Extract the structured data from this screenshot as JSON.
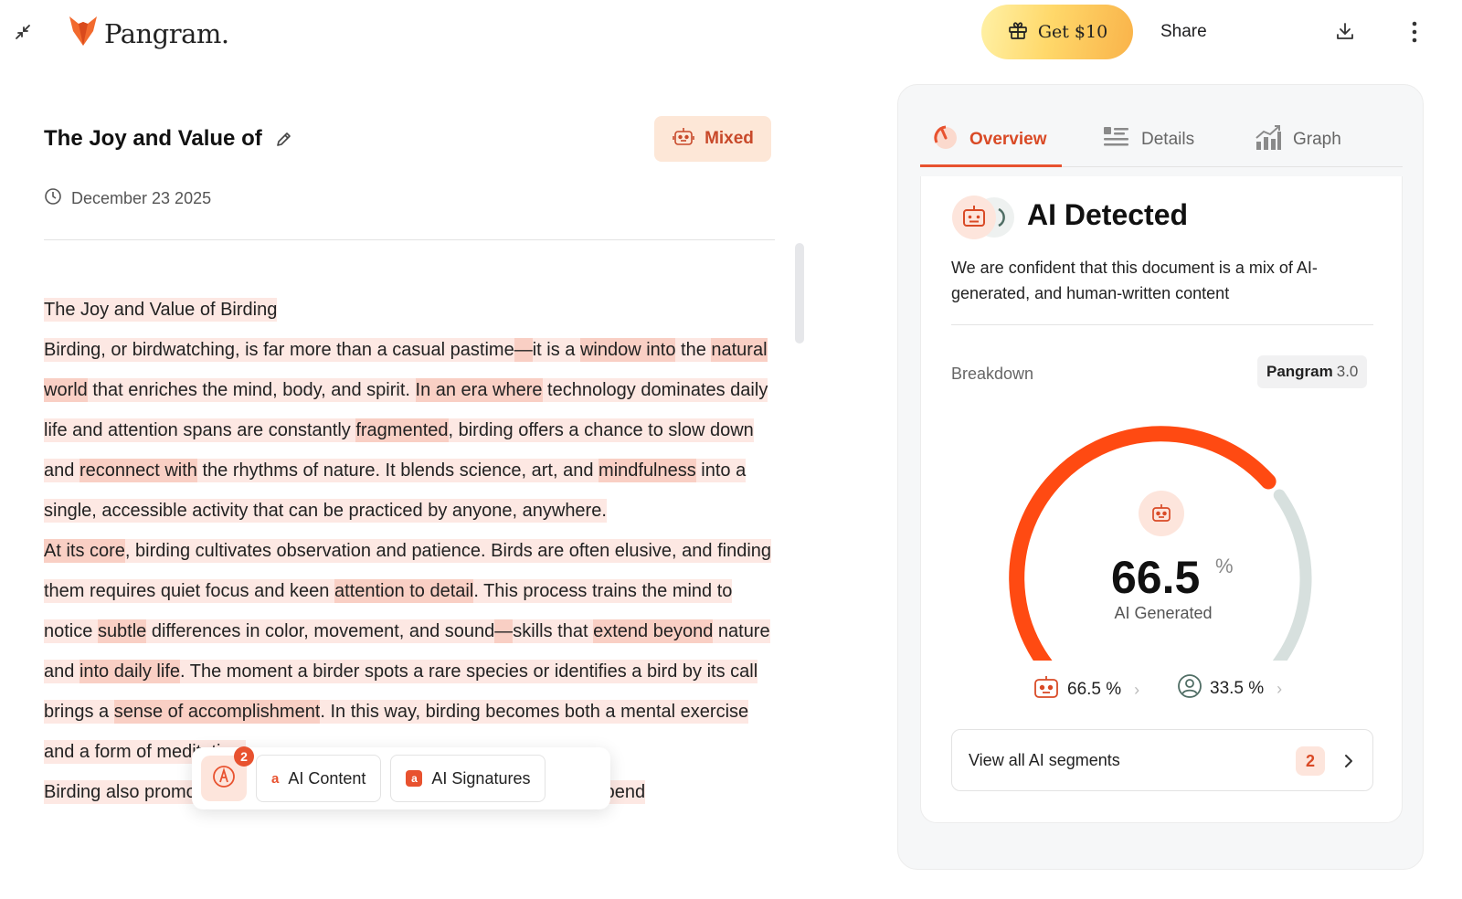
{
  "header": {
    "logo_text": "Pangram.",
    "promo_label": "Get $10",
    "share_label": "Share"
  },
  "document": {
    "title": "The Joy and Value of",
    "badge_label": "Mixed",
    "date": "December 23 2025",
    "paragraphs": [
      [
        {
          "t": "The Joy and Value of Birding",
          "h": 1
        }
      ],
      [
        {
          "t": "Birding, or birdwatching, is far more than a casual pastime",
          "h": 1
        },
        {
          "t": "—",
          "h": 2
        },
        {
          "t": "it is a ",
          "h": 1
        },
        {
          "t": "window into",
          "h": 2
        },
        {
          "t": " the ",
          "h": 1
        },
        {
          "t": "natural world",
          "h": 2
        },
        {
          "t": " that enriches the mind, body, and spirit. ",
          "h": 1
        },
        {
          "t": "In an era where",
          "h": 2
        },
        {
          "t": " technology dominates daily life and attention spans are constantly ",
          "h": 1
        },
        {
          "t": "fragmented",
          "h": 2
        },
        {
          "t": ", birding offers a chance to slow down and ",
          "h": 1
        },
        {
          "t": "reconnect with",
          "h": 2
        },
        {
          "t": " the rhythms of nature. It blends science, art, and ",
          "h": 1
        },
        {
          "t": "mindfulness",
          "h": 2
        },
        {
          "t": " into a single, accessible activity that can be practiced by anyone, anywhere.",
          "h": 1
        }
      ],
      [
        {
          "t": "At its core",
          "h": 2
        },
        {
          "t": ", birding cultivates observation and patience. Birds are often elusive, and finding them requires quiet focus and keen ",
          "h": 1
        },
        {
          "t": "attention to detail",
          "h": 2
        },
        {
          "t": ". This process trains the mind to notice ",
          "h": 1
        },
        {
          "t": "subtle",
          "h": 2
        },
        {
          "t": " differences in color, movement, and sound",
          "h": 1
        },
        {
          "t": "—",
          "h": 2
        },
        {
          "t": "skills that ",
          "h": 1
        },
        {
          "t": "extend beyond",
          "h": 2
        },
        {
          "t": " nature and ",
          "h": 1
        },
        {
          "t": "into daily life",
          "h": 2
        },
        {
          "t": ". The moment a birder spots a rare species or identifies a bird by its call brings a ",
          "h": 1
        },
        {
          "t": "sense of accomplishment",
          "h": 2
        },
        {
          "t": ". In this way, birding becomes both a mental exercise and a form of meditation.",
          "h": 1
        }
      ],
      [
        {
          "t": "Birding also promotes physical and mental well-being. Many birders spend",
          "h": 1
        }
      ]
    ]
  },
  "floating_toolbar": {
    "notification_count": "2",
    "ai_content_label": "AI Content",
    "ai_content_glyph": "a",
    "ai_signatures_label": "AI Signatures",
    "ai_signatures_glyph": "a"
  },
  "panel": {
    "tabs": [
      {
        "label": "Overview",
        "active": true,
        "icon": "gauge-icon"
      },
      {
        "label": "Details",
        "active": false,
        "icon": "list-icon"
      },
      {
        "label": "Graph",
        "active": false,
        "icon": "chart-icon"
      }
    ],
    "result_title": "AI Detected",
    "result_description": "We are confident that this document is a mix of AI-generated, and human-written content",
    "breakdown_label": "Breakdown",
    "model_name": "Pangram",
    "model_version": "3.0",
    "gauge": {
      "ai_fraction": 0.665,
      "value_text": "66.5",
      "unit": "%",
      "label": "AI Generated"
    },
    "ai_stat": "66.5 %",
    "human_stat": "33.5 %",
    "segments_label": "View all AI segments",
    "segments_count": "2"
  },
  "colors": {
    "accent": "#e8522f",
    "highlight_light": "#fde8e3",
    "highlight_strong": "#f9cfc4",
    "human_gray": "#d7e0de"
  }
}
